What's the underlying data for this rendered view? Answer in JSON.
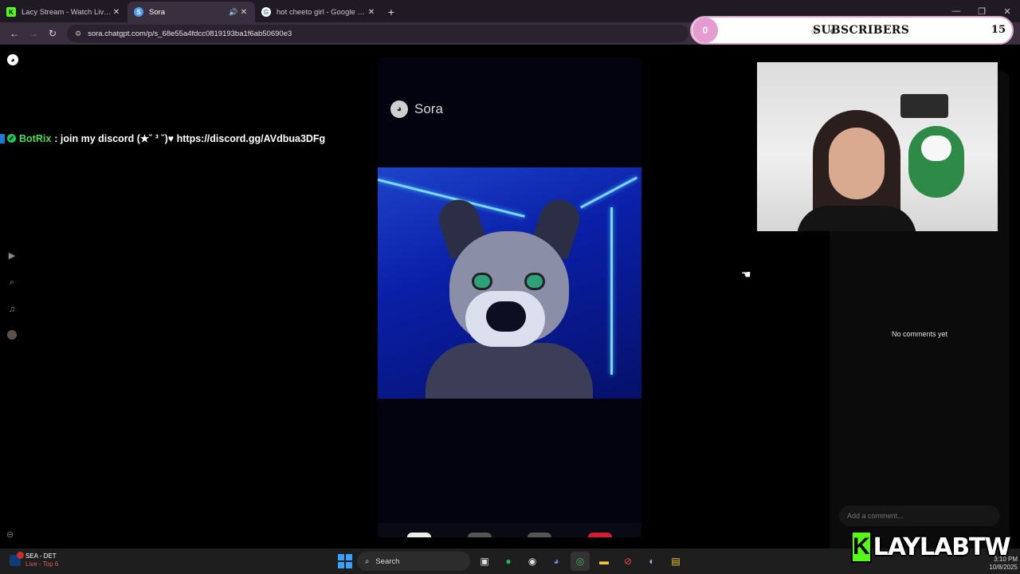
{
  "browser": {
    "tabs": [
      {
        "title": "Lacy Stream - Watch Live on Kick",
        "favicon": "K",
        "favicon_color": "#53fc18"
      },
      {
        "title": "Sora",
        "favicon": "S",
        "favicon_color": "#4f9cf5"
      },
      {
        "title": "hot cheeto girl - Google Search",
        "favicon": "G",
        "favicon_color": "#ffffff"
      }
    ],
    "url": "sora.chatgpt.com/p/s_68e55a4fdcc0819193ba1f6ab50690e3"
  },
  "stream_overlay": {
    "subscriber_count": "0",
    "subscribers_label": "SUBSCRIBERS",
    "subscriber_goal": "15",
    "chat_user": "BotRix",
    "chat_message": ": join my discord (★˘ ³ ˘)♥ https://discord.gg/AVdbua3DFg",
    "brand_letter": "K",
    "brand_name": "LAYLABTW"
  },
  "sora": {
    "watermark": "Sora",
    "no_comments": "No comments yet",
    "comment_placeholder": "Add a comment..."
  },
  "taskbar": {
    "weather_title": "SEA - DET",
    "weather_sub": "Live - Top 6",
    "search_placeholder": "Search",
    "time": "3:10 PM",
    "date": "10/8/2025"
  },
  "colors": {
    "kick_green": "#53fc18",
    "subscriber_pink": "#e49bcf"
  }
}
